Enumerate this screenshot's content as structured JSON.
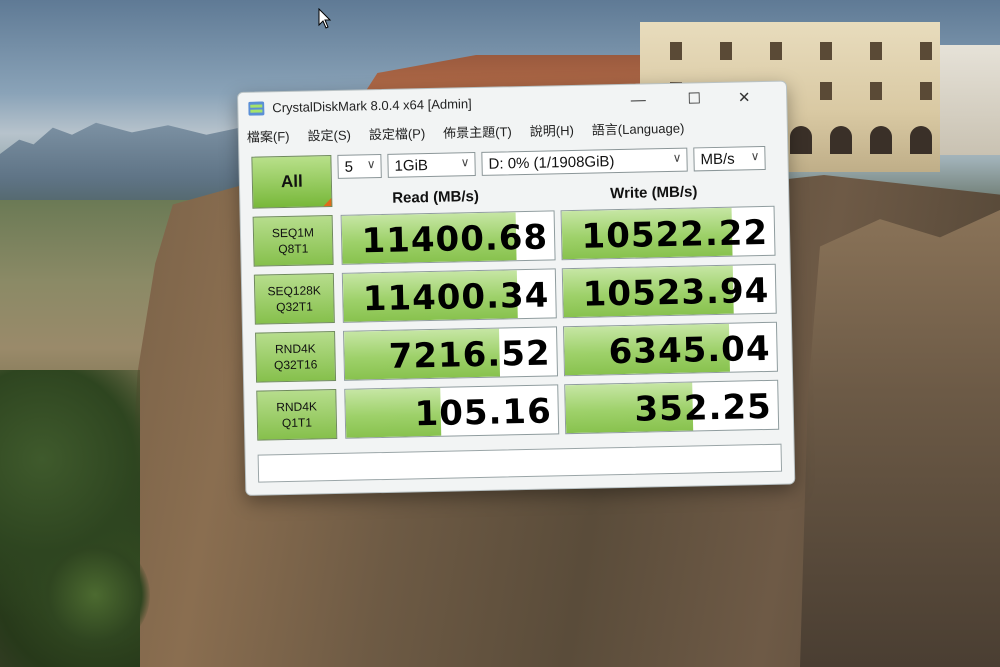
{
  "window": {
    "title": "CrystalDiskMark 8.0.4 x64 [Admin]",
    "minimize": "—",
    "maximize": "☐",
    "close": "✕"
  },
  "menu": [
    "檔案(F)",
    "設定(S)",
    "設定檔(P)",
    "佈景主題(T)",
    "說明(H)",
    "語言(Language)"
  ],
  "controls": {
    "all_label": "All",
    "count": "5",
    "size": "1GiB",
    "drive": "D: 0% (1/1908GiB)",
    "unit": "MB/s"
  },
  "headers": {
    "read": "Read (MB/s)",
    "write": "Write (MB/s)"
  },
  "rows": [
    {
      "l1": "SEQ1M",
      "l2": "Q8T1",
      "read": "11400.68",
      "write": "10522.22",
      "read_level": 0.82,
      "write_level": 0.8
    },
    {
      "l1": "SEQ128K",
      "l2": "Q32T1",
      "read": "11400.34",
      "write": "10523.94",
      "read_level": 0.82,
      "write_level": 0.8
    },
    {
      "l1": "RND4K",
      "l2": "Q32T16",
      "read": "7216.52",
      "write": "6345.04",
      "read_level": 0.73,
      "write_level": 0.78
    },
    {
      "l1": "RND4K",
      "l2": "Q1T1",
      "read": "105.16",
      "write": "352.25",
      "read_level": 0.45,
      "write_level": 0.6
    }
  ],
  "colors": {
    "accent_green": "#86c04c",
    "bar_green": "#9ed16a",
    "all_corner": "#e06a1a"
  }
}
